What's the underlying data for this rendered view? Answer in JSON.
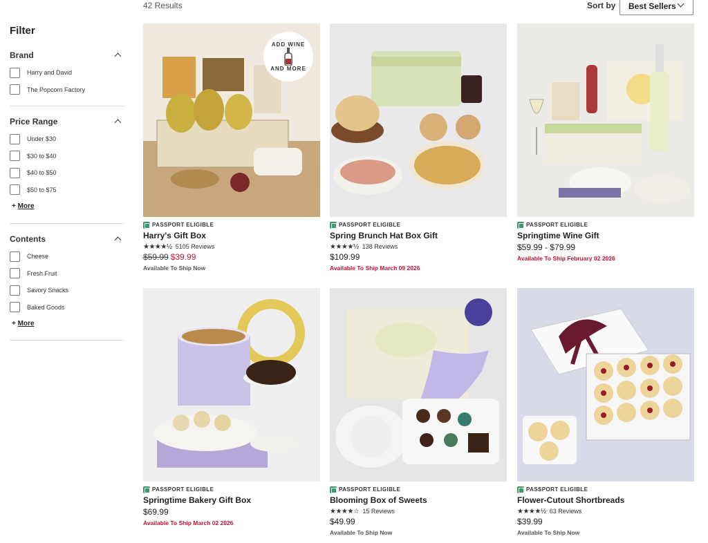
{
  "results_count": "42 Results",
  "sort": {
    "label": "Sort by",
    "selected": "Best Sellers"
  },
  "sidebar": {
    "title": "Filter",
    "groups": [
      {
        "title": "Brand",
        "options": [
          "Harry and David",
          "The Popcorn Factory"
        ],
        "more": ""
      },
      {
        "title": "Price Range",
        "options": [
          "Under $30",
          "$30 to $40",
          "$40 to $50",
          "$50 to $75"
        ],
        "more": "More"
      },
      {
        "title": "Contents",
        "options": [
          "Cheese",
          "Fresh Fruit",
          "Savory Snacks",
          "Baked Goods"
        ],
        "more": "More"
      }
    ]
  },
  "badge": {
    "line1": "ADD WINE",
    "line2": "AND MORE"
  },
  "passport_label": "PASSPORT ELIGIBLE",
  "products": [
    {
      "name": "Harry's Gift Box",
      "stars": "★★★★½",
      "reviews": "5105 Reviews",
      "old_price": "$59.99",
      "price": "$39.99",
      "ship": "Available To Ship Now",
      "ship_type": "now"
    },
    {
      "name": "Spring Brunch Hat Box Gift",
      "stars": "★★★★½",
      "reviews": "138 Reviews",
      "old_price": "",
      "price": "$109.99",
      "ship": "Available To Ship March 09 2026",
      "ship_type": "later"
    },
    {
      "name": "Springtime Wine Gift",
      "stars": "",
      "reviews": "",
      "old_price": "",
      "price": "$59.99 - $79.99",
      "ship": "Available To Ship February 02 2026",
      "ship_type": "later"
    },
    {
      "name": "Springtime Bakery Gift Box",
      "stars": "",
      "reviews": "",
      "old_price": "",
      "price": "$69.99",
      "ship": "Available To Ship March 02 2026",
      "ship_type": "later"
    },
    {
      "name": "Blooming Box of Sweets",
      "stars": "★★★★☆",
      "reviews": "15 Reviews",
      "old_price": "",
      "price": "$49.99",
      "ship": "Available To Ship Now",
      "ship_type": "now"
    },
    {
      "name": "Flower-Cutout Shortbreads",
      "stars": "★★★★½",
      "reviews": "63 Reviews",
      "old_price": "",
      "price": "$39.99",
      "ship": "Available To Ship Now",
      "ship_type": "now"
    }
  ],
  "colors": {
    "sale": "#c41230",
    "passport": "#3a9a6a"
  }
}
